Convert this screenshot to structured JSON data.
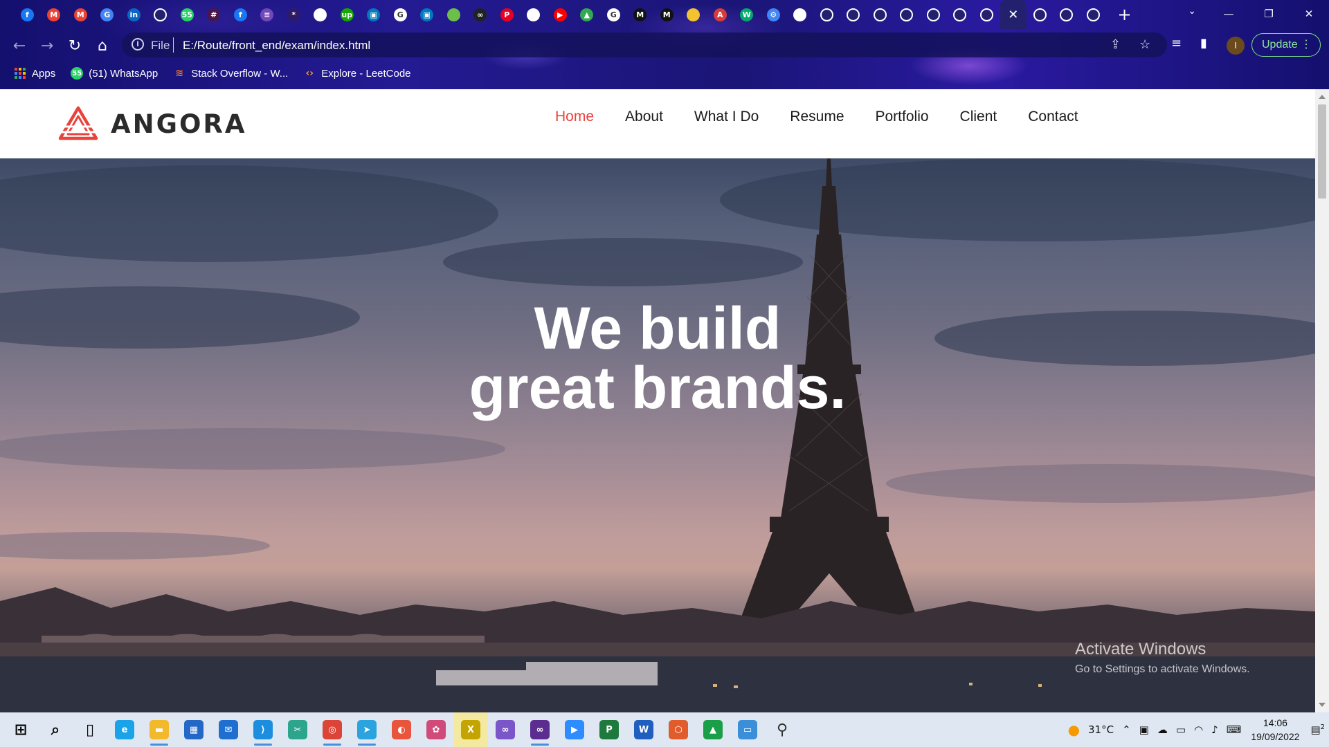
{
  "browser": {
    "tabs": [
      {
        "icon": "facebook-icon",
        "color": "#1877f2",
        "glyph": "f"
      },
      {
        "icon": "gmail-icon",
        "color": "#ea4335",
        "glyph": "M"
      },
      {
        "icon": "gmail-icon",
        "color": "#ea4335",
        "glyph": "M"
      },
      {
        "icon": "google-translate-icon",
        "color": "#4285f4",
        "glyph": "G"
      },
      {
        "icon": "linkedin-icon",
        "color": "#0a66c2",
        "glyph": "in"
      },
      {
        "icon": "globe-icon",
        "color": "#ffffff",
        "glyph": ""
      },
      {
        "icon": "whatsapp-icon",
        "color": "#25d366",
        "glyph": "55"
      },
      {
        "icon": "slack-icon",
        "color": "#4a154b",
        "glyph": "#"
      },
      {
        "icon": "facebook-icon",
        "color": "#1877f2",
        "glyph": "f"
      },
      {
        "icon": "forms-icon",
        "color": "#7248b9",
        "glyph": "≡"
      },
      {
        "icon": "figma-like-icon",
        "color": "#2d1b69",
        "glyph": "*"
      },
      {
        "icon": "docs-icon",
        "color": "#ffffff",
        "glyph": ""
      },
      {
        "icon": "upwork-icon",
        "color": "#14a800",
        "glyph": "up"
      },
      {
        "icon": "trello-icon",
        "color": "#0079bf",
        "glyph": "▣"
      },
      {
        "icon": "google-icon",
        "color": "#ffffff",
        "glyph": "G"
      },
      {
        "icon": "trello-icon",
        "color": "#0079bf",
        "glyph": "▣"
      },
      {
        "icon": "leaf-icon",
        "color": "#6cc04a",
        "glyph": ""
      },
      {
        "icon": "infinity-icon",
        "color": "#222222",
        "glyph": "∞"
      },
      {
        "icon": "pinterest-icon",
        "color": "#e60023",
        "glyph": "P"
      },
      {
        "icon": "github-icon",
        "color": "#ffffff",
        "glyph": ""
      },
      {
        "icon": "youtube-icon",
        "color": "#ff0000",
        "glyph": "▶"
      },
      {
        "icon": "drive-icon",
        "color": "#34a853",
        "glyph": "▲"
      },
      {
        "icon": "google-icon",
        "color": "#ffffff",
        "glyph": "G"
      },
      {
        "icon": "medium-icon",
        "color": "#111111",
        "glyph": "M"
      },
      {
        "icon": "medium-icon",
        "color": "#111111",
        "glyph": "M"
      },
      {
        "icon": "note-icon",
        "color": "#f2c230",
        "glyph": ""
      },
      {
        "icon": "ai-icon",
        "color": "#d83b3b",
        "glyph": "A"
      },
      {
        "icon": "w3schools-icon",
        "color": "#04aa6d",
        "glyph": "W"
      },
      {
        "icon": "gear-icon",
        "color": "#4285f4",
        "glyph": "⚙"
      },
      {
        "icon": "store-icon",
        "color": "#ffffff",
        "glyph": ""
      },
      {
        "icon": "globe-icon",
        "color": "#ffffff",
        "glyph": ""
      },
      {
        "icon": "globe-icon",
        "color": "#ffffff",
        "glyph": ""
      },
      {
        "icon": "globe-icon",
        "color": "#ffffff",
        "glyph": ""
      },
      {
        "icon": "globe-icon",
        "color": "#ffffff",
        "glyph": ""
      },
      {
        "icon": "globe-icon",
        "color": "#ffffff",
        "glyph": ""
      },
      {
        "icon": "globe-icon",
        "color": "#ffffff",
        "glyph": ""
      },
      {
        "icon": "globe-icon",
        "color": "#ffffff",
        "glyph": ""
      },
      {
        "icon": "close-icon",
        "color": "#ffffff",
        "glyph": "✕",
        "active": true
      },
      {
        "icon": "globe-icon",
        "color": "#ffffff",
        "glyph": ""
      },
      {
        "icon": "globe-icon",
        "color": "#ffffff",
        "glyph": ""
      },
      {
        "icon": "globe-icon",
        "color": "#ffffff",
        "glyph": ""
      }
    ],
    "address": {
      "scheme": "File",
      "url": "E:/Route/front_end/exam/index.html"
    },
    "update_label": "Update",
    "profile_initial": "I",
    "bookmarks": [
      {
        "label": "Apps",
        "icon": "apps-grid-icon"
      },
      {
        "label": "(51) WhatsApp",
        "icon": "whatsapp-icon",
        "badge": "55"
      },
      {
        "label": "Stack Overflow - W...",
        "icon": "stackoverflow-icon"
      },
      {
        "label": "Explore - LeetCode",
        "icon": "leetcode-icon"
      }
    ]
  },
  "site": {
    "logo_text": "ANGORA",
    "brand_color": "#e8423b",
    "nav": [
      {
        "label": "Home",
        "active": true
      },
      {
        "label": "About"
      },
      {
        "label": "What I Do"
      },
      {
        "label": "Resume"
      },
      {
        "label": "Portfolio"
      },
      {
        "label": "Client"
      },
      {
        "label": "Contact"
      }
    ],
    "hero": {
      "line1": "We build",
      "line2": "great brands."
    }
  },
  "watermark": {
    "line1": "Activate Windows",
    "line2": "Go to Settings to activate Windows."
  },
  "taskbar": {
    "apps": [
      {
        "icon": "windows-start-icon",
        "color": "#0a0a0a"
      },
      {
        "icon": "search-icon",
        "color": "#0a0a0a"
      },
      {
        "icon": "task-view-icon",
        "color": "#0a0a0a"
      },
      {
        "icon": "edge-icon",
        "color": "#1aa3e8"
      },
      {
        "icon": "file-explorer-icon",
        "color": "#f2b92c",
        "running": true
      },
      {
        "icon": "store-icon",
        "color": "#2468c7"
      },
      {
        "icon": "mail-icon",
        "color": "#1f6fd1"
      },
      {
        "icon": "vscode-icon",
        "color": "#1c8ee0",
        "running": true
      },
      {
        "icon": "snip-icon",
        "color": "#2ca58d"
      },
      {
        "icon": "chrome-icon",
        "color": "#db4437",
        "running": true
      },
      {
        "icon": "telegram-icon",
        "color": "#2aa3df",
        "running": true
      },
      {
        "icon": "paint-icon",
        "color": "#e8553c"
      },
      {
        "icon": "network-icon",
        "color": "#d14b7a"
      },
      {
        "icon": "xd-icon",
        "color": "#c4a400",
        "highlight": true
      },
      {
        "icon": "visual-studio-icon",
        "color": "#7b56c9"
      },
      {
        "icon": "visual-studio-icon",
        "color": "#5c2d91",
        "running": true
      },
      {
        "icon": "zoom-icon",
        "color": "#2d8cff"
      },
      {
        "icon": "project-icon",
        "color": "#1e7a3c"
      },
      {
        "icon": "word-icon",
        "color": "#1f5fbf"
      },
      {
        "icon": "cube-icon",
        "color": "#e05c2c"
      },
      {
        "icon": "drive-icon",
        "color": "#1a9e48"
      },
      {
        "icon": "remote-desktop-icon",
        "color": "#3a8fd8"
      },
      {
        "icon": "people-icon",
        "color": "#333333"
      }
    ],
    "weather_temp": "31°C",
    "time": "14:06",
    "date": "19/09/2022",
    "notifications": "2"
  }
}
